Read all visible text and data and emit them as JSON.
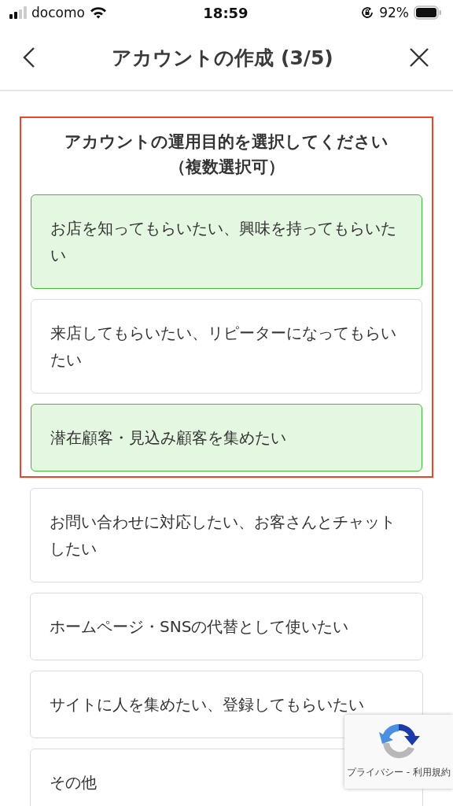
{
  "status_bar": {
    "carrier": "docomo",
    "time": "18:59",
    "battery": "92%"
  },
  "header": {
    "title": "アカウントの作成 (3/5)"
  },
  "highlight_frame": {
    "prompt": [
      "アカウントの運用目的を選択してください",
      "（複数選択可）"
    ],
    "options": [
      {
        "label": "お店を知ってもらいたい、興味を持ってもらいたい",
        "selected": true
      },
      {
        "label": "来店してもらいたい、リピーターになってもらいたい",
        "selected": false
      },
      {
        "label": "潜在顧客・見込み顧客を集めたい",
        "selected": true
      }
    ]
  },
  "options": [
    {
      "label": "お問い合わせに対応したい、お客さんとチャットしたい",
      "selected": false
    },
    {
      "label": "ホームページ・SNSの代替として使いたい",
      "selected": false
    },
    {
      "label": "サイトに人を集めたい、登録してもらいたい",
      "selected": false
    },
    {
      "label": "その他",
      "selected": false
    }
  ],
  "recaptcha": {
    "links": "プライバシー - 利用規約"
  }
}
